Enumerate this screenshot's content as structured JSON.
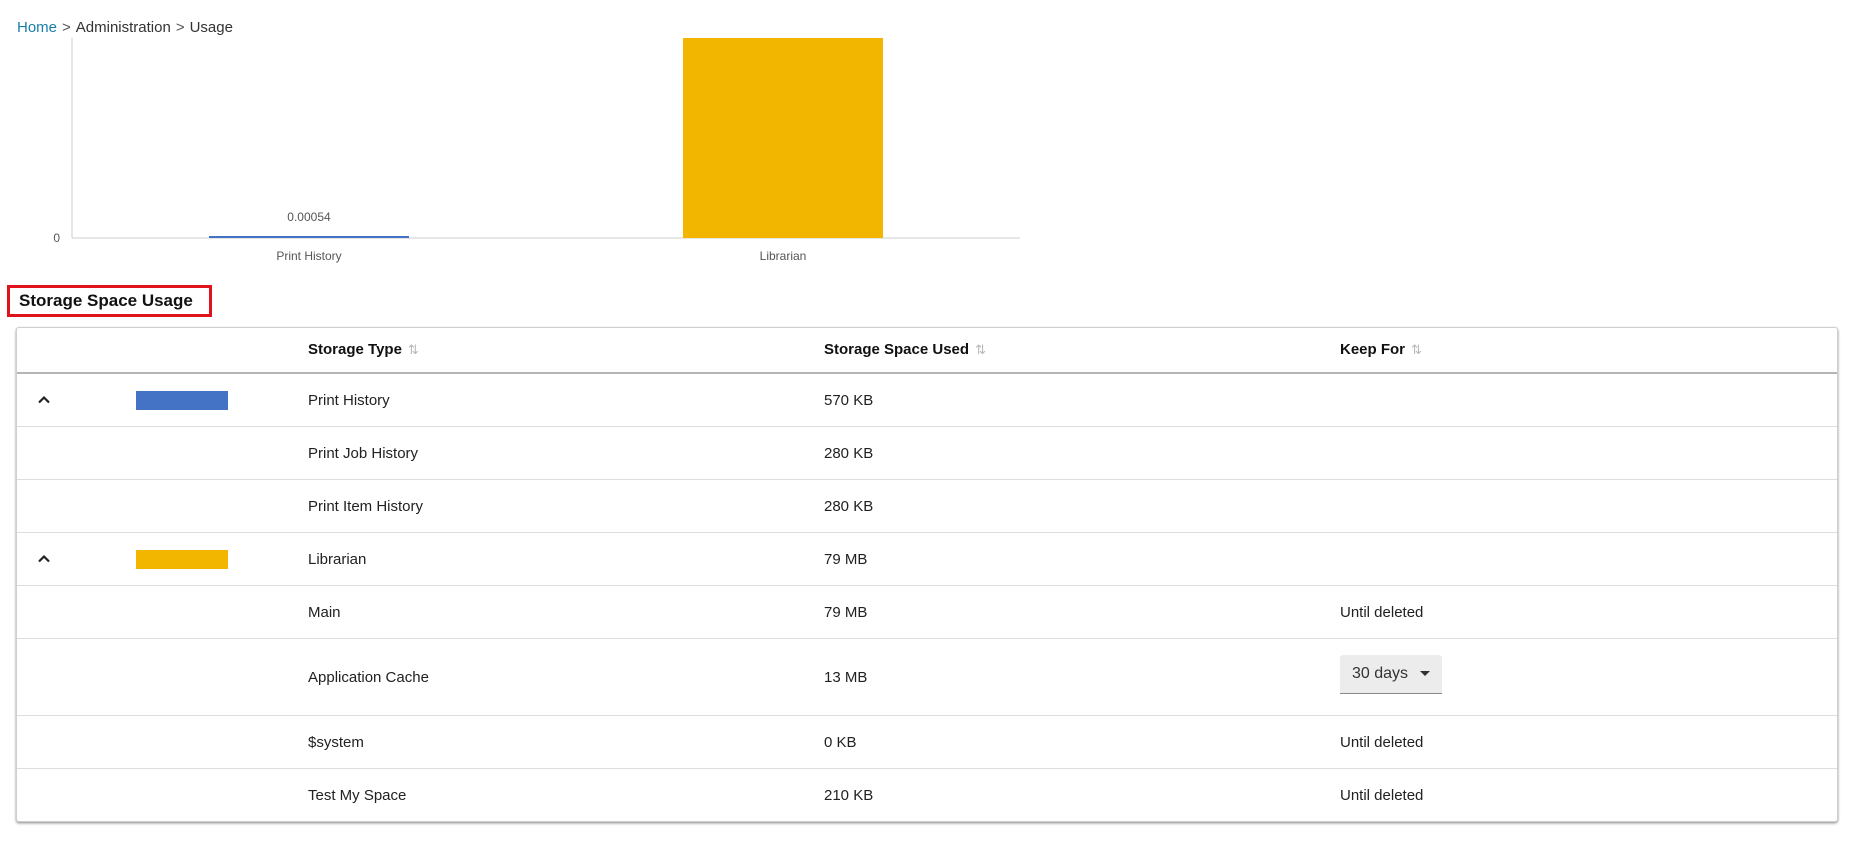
{
  "breadcrumb": {
    "home": "Home",
    "separator": ">",
    "administration": "Administration",
    "current": "Usage"
  },
  "chart_data": {
    "type": "bar",
    "categories": [
      "Print History",
      "Librarian"
    ],
    "values": [
      0.00054,
      79
    ],
    "data_labels": [
      "0.00054",
      ""
    ],
    "colors": [
      "#4472c4",
      "#f2b600"
    ],
    "y_ticks": [
      "0"
    ],
    "ylim": [
      0,
      79
    ],
    "title": "",
    "xlabel": "",
    "ylabel": "",
    "grid": false
  },
  "section": {
    "title": "Storage Space Usage"
  },
  "table": {
    "headers": {
      "storage_type": "Storage Type",
      "storage_space_used": "Storage Space Used",
      "keep_for": "Keep For"
    },
    "rows": [
      {
        "type": "Print History",
        "used": "570 KB",
        "keep": "",
        "group": true,
        "color": "#4472c4"
      },
      {
        "type": "Print Job History",
        "used": "280 KB",
        "keep": ""
      },
      {
        "type": "Print Item History",
        "used": "280 KB",
        "keep": ""
      },
      {
        "type": "Librarian",
        "used": "79 MB",
        "keep": "",
        "group": true,
        "color": "#f2b600"
      },
      {
        "type": "Main",
        "used": "79 MB",
        "keep": "Until deleted"
      },
      {
        "type": "Application Cache",
        "used": "13 MB",
        "keep_select": "30 days"
      },
      {
        "type": "$system",
        "used": "0 KB",
        "keep": "Until deleted"
      },
      {
        "type": "Test My Space",
        "used": "210 KB",
        "keep": "Until deleted"
      }
    ]
  },
  "icons": {
    "collapse": "chevron-up-icon",
    "sort": "sort-icon",
    "dropdown": "caret-down-icon"
  }
}
